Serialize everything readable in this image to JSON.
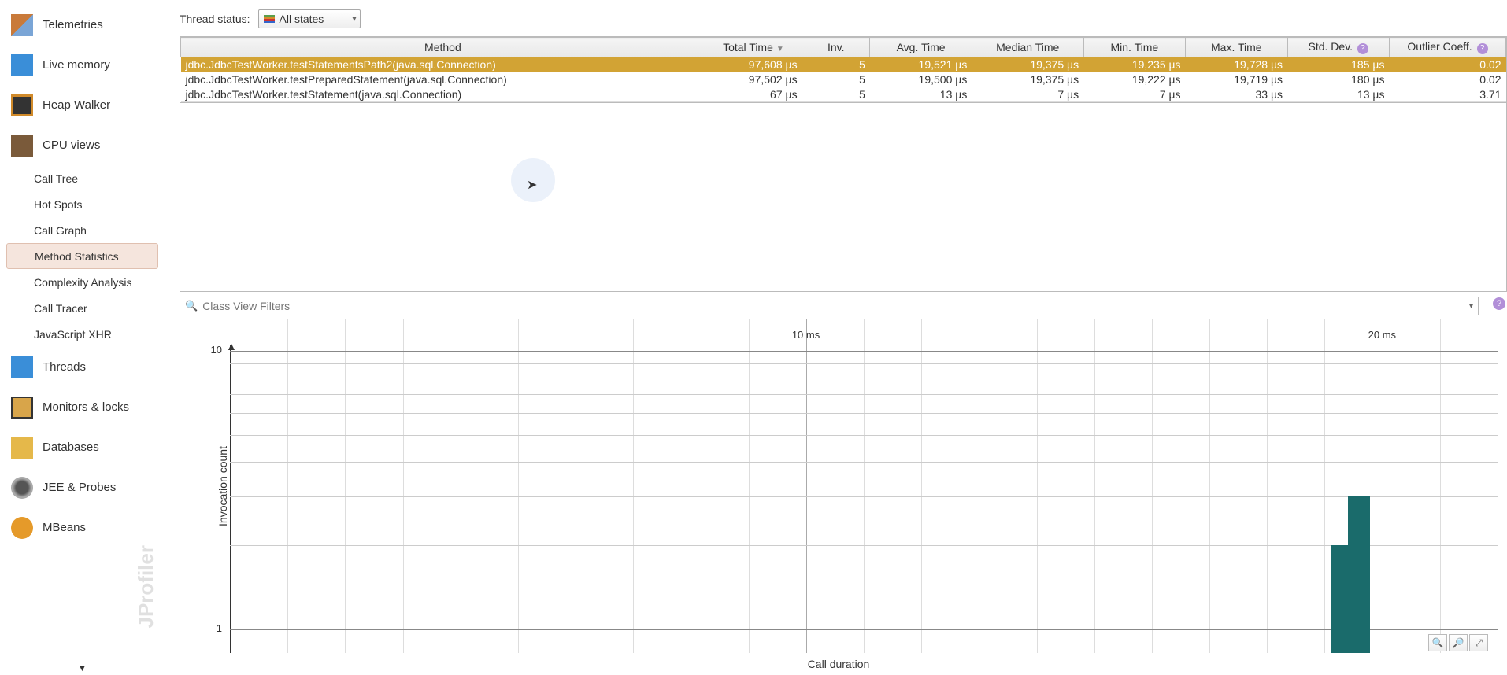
{
  "sidebar": {
    "items": [
      {
        "label": "Telemetries"
      },
      {
        "label": "Live memory"
      },
      {
        "label": "Heap Walker"
      },
      {
        "label": "CPU views"
      },
      {
        "label": "Threads"
      },
      {
        "label": "Monitors & locks"
      },
      {
        "label": "Databases"
      },
      {
        "label": "JEE & Probes"
      },
      {
        "label": "MBeans"
      }
    ],
    "cpu_sub": [
      {
        "label": "Call Tree"
      },
      {
        "label": "Hot Spots"
      },
      {
        "label": "Call Graph"
      },
      {
        "label": "Method Statistics"
      },
      {
        "label": "Complexity Analysis"
      },
      {
        "label": "Call Tracer"
      },
      {
        "label": "JavaScript XHR"
      }
    ],
    "watermark": "JProfiler"
  },
  "topbar": {
    "label": "Thread status:",
    "dropdown_value": "All states"
  },
  "table": {
    "columns": [
      "Method",
      "Total Time",
      "Inv.",
      "Avg. Time",
      "Median Time",
      "Min. Time",
      "Max. Time",
      "Std. Dev.",
      "Outlier Coeff."
    ],
    "sort_col": 1,
    "help_cols": [
      7,
      8
    ],
    "rows": [
      {
        "method": "jdbc.JdbcTestWorker.testStatementsPath2(java.sql.Connection)",
        "total": "97,608 µs",
        "inv": "5",
        "avg": "19,521 µs",
        "median": "19,375 µs",
        "min": "19,235 µs",
        "max": "19,728 µs",
        "std": "185 µs",
        "out": "0.02",
        "selected": true
      },
      {
        "method": "jdbc.JdbcTestWorker.testPreparedStatement(java.sql.Connection)",
        "total": "97,502 µs",
        "inv": "5",
        "avg": "19,500 µs",
        "median": "19,375 µs",
        "min": "19,222 µs",
        "max": "19,719 µs",
        "std": "180 µs",
        "out": "0.02",
        "selected": false
      },
      {
        "method": "jdbc.JdbcTestWorker.testStatement(java.sql.Connection)",
        "total": "67 µs",
        "inv": "5",
        "avg": "13 µs",
        "median": "7 µs",
        "min": "7 µs",
        "max": "33 µs",
        "std": "13 µs",
        "out": "3.71",
        "selected": false
      }
    ]
  },
  "filter": {
    "placeholder": "Class View Filters"
  },
  "chart_data": {
    "type": "bar",
    "title": "",
    "xlabel": "Call duration",
    "ylabel": "Invocation count",
    "x_ticks": [
      "10 ms",
      "20 ms"
    ],
    "y_ticks": [
      "1",
      "10"
    ],
    "yscale": "log",
    "bars": [
      {
        "x_ms": 19.3,
        "count": 2
      },
      {
        "x_ms": 19.6,
        "count": 3
      }
    ]
  }
}
